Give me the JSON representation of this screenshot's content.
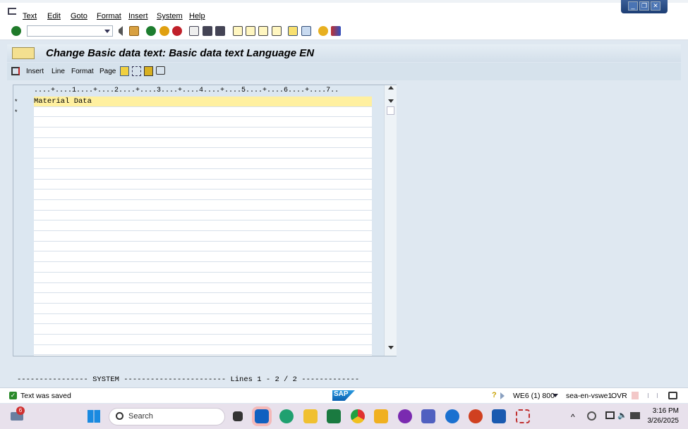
{
  "menu": {
    "items": [
      "Text",
      "Edit",
      "Goto",
      "Format",
      "Insert",
      "System",
      "Help"
    ]
  },
  "toolbar": {
    "command_value": ""
  },
  "title": "Change Basic data text: Basic data text Language EN",
  "app_toolbar": {
    "items": [
      "Insert",
      "Line",
      "Format",
      "Page"
    ]
  },
  "editor": {
    "ruler": "....+....1....+....2....+....3....+....4....+....5....+....6....+....7..",
    "lines": [
      {
        "marker": "*",
        "text": "Material Data"
      },
      {
        "marker": "*",
        "text": ""
      }
    ]
  },
  "footer": "---------------- SYSTEM ----------------------- Lines 1 - 2 / 2 -------------",
  "status": {
    "message": "Text was saved",
    "system": "WE6 (1) 800",
    "server": "sea-en-vswe1",
    "mode": "OVR",
    "brand": "SAP"
  },
  "taskbar": {
    "search_placeholder": "Search",
    "time": "3:16 PM",
    "date": "3/26/2025",
    "notification_count": "6"
  },
  "colors": {
    "accent": "#1d3e74",
    "highlight": "#fff0a0"
  }
}
